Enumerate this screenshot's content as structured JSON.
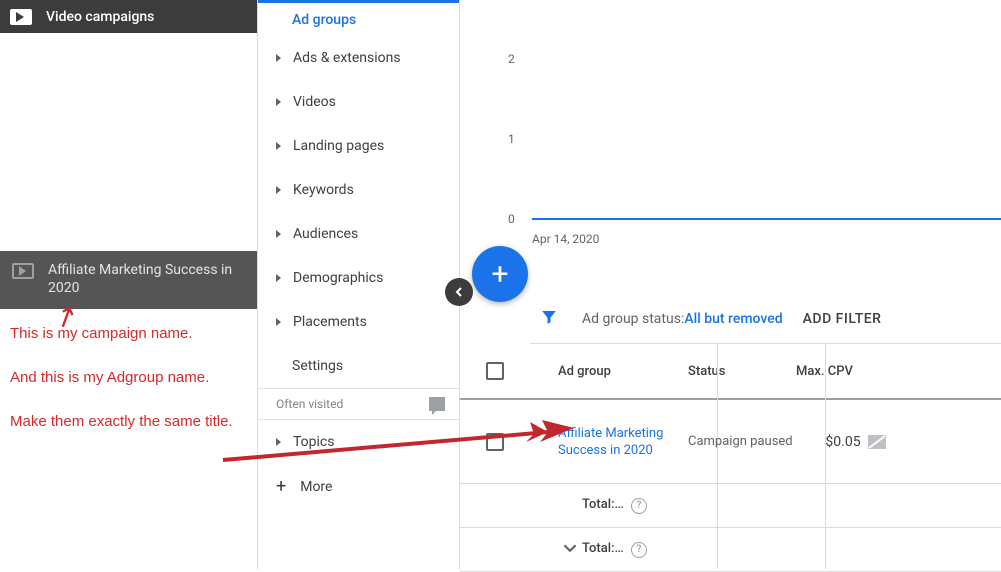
{
  "sidebar": {
    "header": "Video campaigns",
    "campaign_name": "Affiliate Marketing Success in 2020"
  },
  "annotations": {
    "line1": "This is my campaign name.",
    "line2": "And this is my Adgroup name.",
    "line3": "Make them exactly the same title."
  },
  "nav": {
    "active": "Ad groups",
    "items": [
      "Ads & extensions",
      "Videos",
      "Landing pages",
      "Keywords",
      "Audiences",
      "Demographics",
      "Placements"
    ],
    "settings": "Settings",
    "often": "Often visited",
    "topics": "Topics",
    "more": "More"
  },
  "chart_data": {
    "type": "line",
    "y_ticks": [
      "2",
      "1",
      "0"
    ],
    "x_label": "Apr 14, 2020",
    "values_note": "flat at 0"
  },
  "filter": {
    "label": "Ad group status: ",
    "value": "All but removed",
    "add": "ADD FILTER"
  },
  "table": {
    "headers": {
      "adgroup": "Ad group",
      "status": "Status",
      "cpv": "Max. CPV"
    },
    "row": {
      "adgroup": "Affiliate Marketing Success in 2020",
      "status": "Campaign paused",
      "cpv": "$0.05"
    },
    "total1": "Total:…",
    "total2": "Total:…"
  }
}
